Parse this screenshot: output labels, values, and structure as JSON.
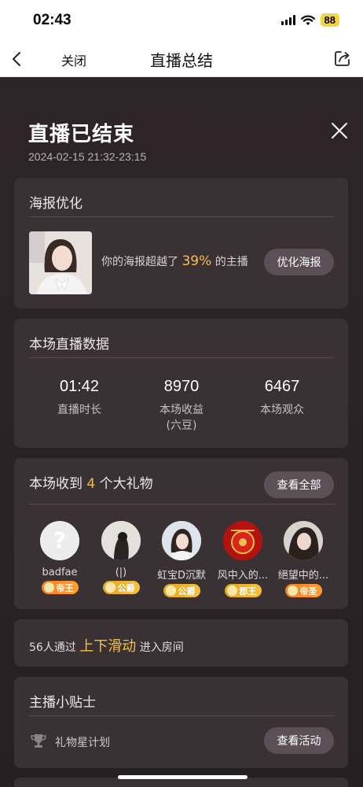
{
  "status_bar": {
    "time": "02:43",
    "battery": "88"
  },
  "nav": {
    "close_label": "关闭",
    "title": "直播总结"
  },
  "header": {
    "title": "直播已结束",
    "date": "2024-02-15 21:32-23:15"
  },
  "poster": {
    "title": "海报优化",
    "text_before": "你的海报超越了",
    "percent": "39%",
    "text_after": "的主播",
    "button": "优化海报"
  },
  "stats": {
    "title": "本场直播数据",
    "items": [
      {
        "value": "01:42",
        "label": "直播时长",
        "sub": ""
      },
      {
        "value": "8970",
        "label": "本场收益",
        "sub": "(六豆)"
      },
      {
        "value": "6467",
        "label": "本场观众",
        "sub": ""
      }
    ]
  },
  "gifts": {
    "title_before": "本场收到",
    "count": "4",
    "title_after": "个大礼物",
    "button": "查看全部",
    "gifters": [
      {
        "name": "badfae",
        "badge": "帝王",
        "badge_color": "#ff7a1f"
      },
      {
        "name": "(|)",
        "badge": "公爵",
        "badge_color": "#e7a51c"
      },
      {
        "name": "虹宝D沉默",
        "badge": "公爵",
        "badge_color": "#e7a51c"
      },
      {
        "name": "风中⼊的...",
        "badge": "郡王",
        "badge_color": "#e7a51c"
      },
      {
        "name": "絕望中的...",
        "badge": "帝圣",
        "badge_color": "#ff7a1f"
      }
    ]
  },
  "slide": {
    "before": "56人通过",
    "highlight": "上下滑动",
    "after": "进入房间"
  },
  "tips": {
    "title": "主播小贴士",
    "item": "礼物星计划",
    "button": "查看活动"
  },
  "colors": {
    "accent": "#f3c04a",
    "background": "#2a2023",
    "card": "#3a3135"
  }
}
